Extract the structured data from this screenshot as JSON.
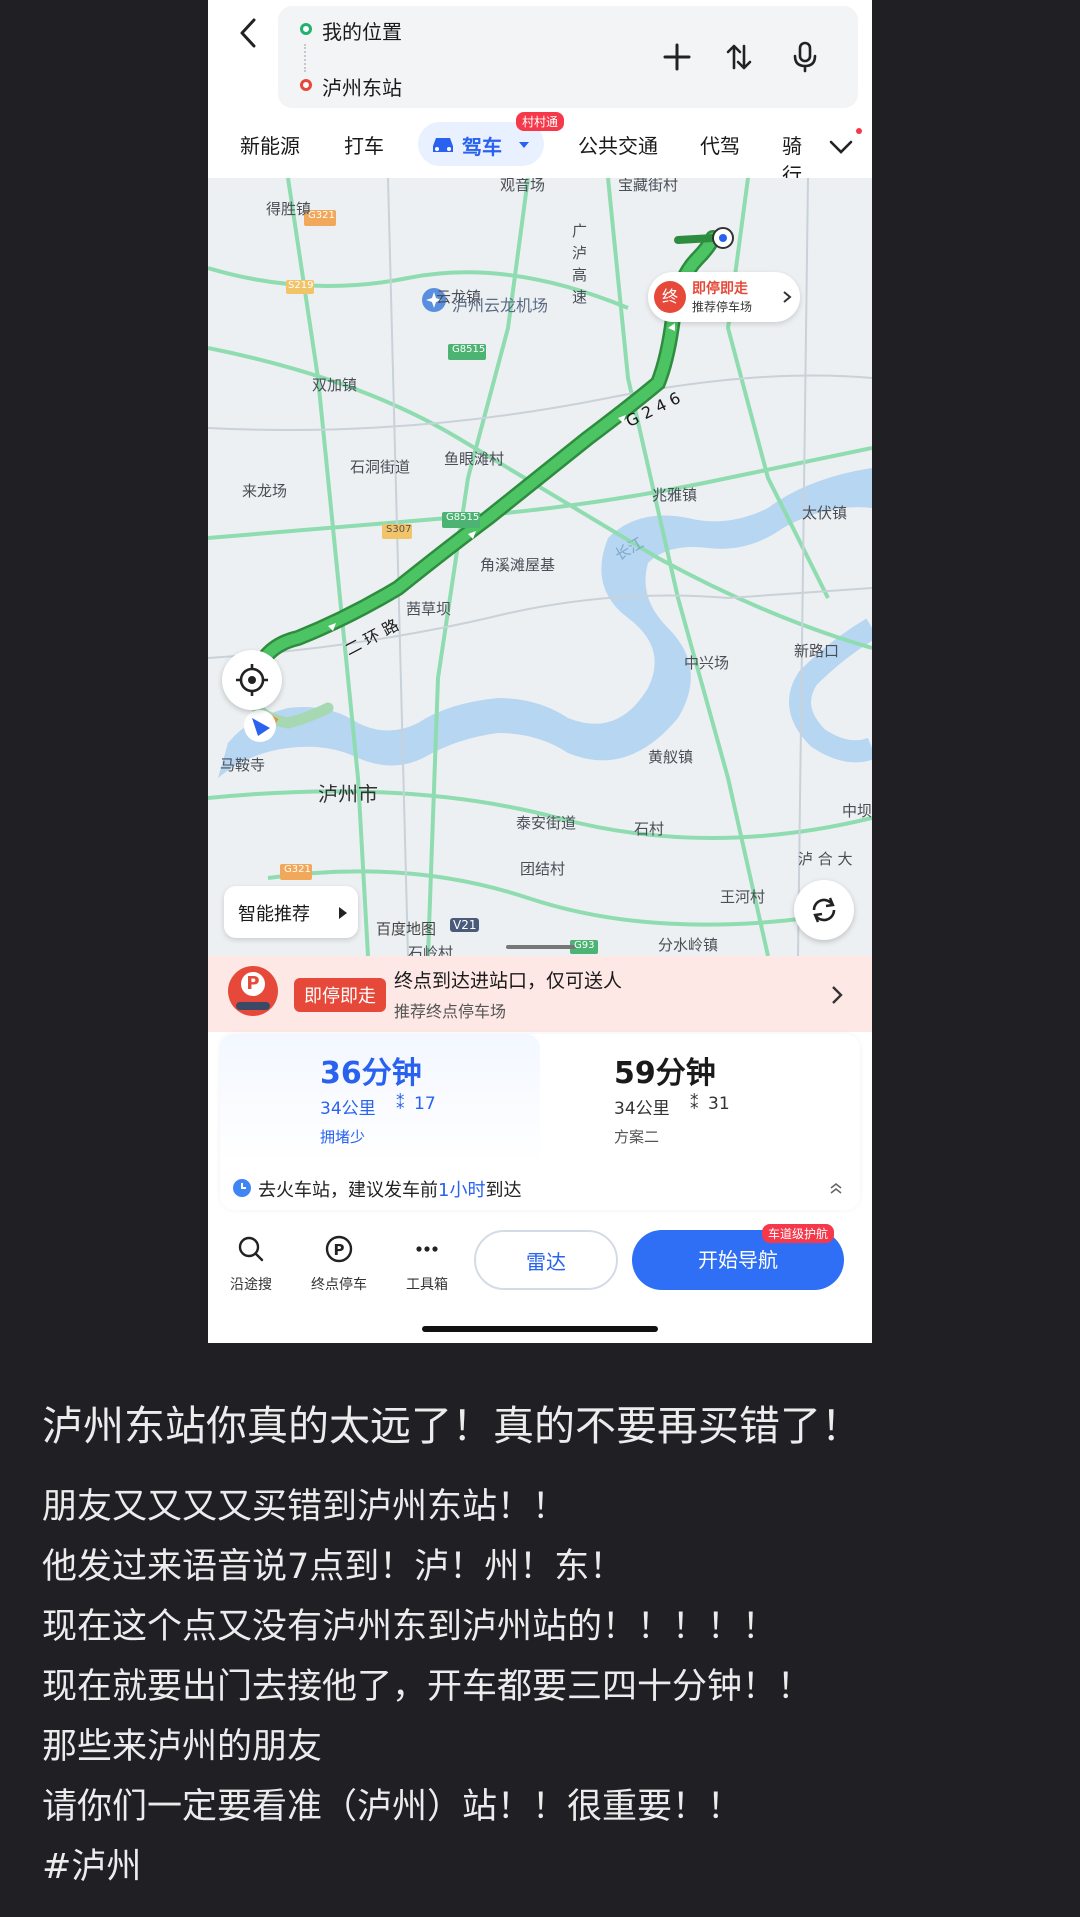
{
  "route": {
    "origin": "我的位置",
    "destination": "泸州东站",
    "origin_color": "#23b26d",
    "destination_color": "#e6493a"
  },
  "modes": {
    "items": [
      "新能源",
      "打车",
      "驾车",
      "公共交通",
      "代驾",
      "骑行"
    ],
    "active": "驾车",
    "active_badge": "村村通"
  },
  "map": {
    "labels": {
      "guanyinchang": "观音场",
      "baozang": "宝藏街村",
      "desheng": "得胜镇",
      "g321a": "G321",
      "yunlong": "云龙镇",
      "lu_highway": "广 泸 高 速",
      "s219": "S219",
      "airport": "泸州云龙机场",
      "shuangjia": "双加镇",
      "g8515a": "G8515",
      "shidong": "石洞街道",
      "yuyan": "鱼眼滩村",
      "zhaoya": "兆雅镇",
      "taifu": "太伏镇",
      "lailong": "来龙场",
      "road_g246": "G 2 4 6",
      "road_ring": "二 环 路",
      "changjiang": "长江",
      "s307": "S307",
      "g8515b": "G8515",
      "jiaoxitan": "角溪滩屋基",
      "zhongxing": "中兴场",
      "xinlukou": "新路口",
      "qiancaoba": "茜草坝",
      "masi": "马鞍寺",
      "luzhou_city": "泸州市",
      "huangyi": "黄舣镇",
      "taian": "泰安街道",
      "shicun": "石村",
      "zhongba": "中坝",
      "tuanjie": "团结村",
      "luhe": "泸 合 大",
      "wanghe": "王河村",
      "g321b": "G321",
      "fenshui": "分水岭镇",
      "shilingcun": "石岭村",
      "g93": "G93",
      "baidu": "百度地图",
      "baidu_ver": "V21"
    },
    "parking_chip": {
      "marker": "终",
      "title": "即停即走",
      "subtitle": "推荐停车场"
    },
    "smart_recommend": "智能推荐",
    "route_color": "#3cb455"
  },
  "alert": {
    "tag": "即停即走",
    "title": "终点到达进站口，仅可送人",
    "subtitle": "推荐终点停车场"
  },
  "plans": [
    {
      "time": "36分钟",
      "distance": "34公里",
      "lights": "17",
      "note": "拥堵少",
      "selected": true
    },
    {
      "time": "59分钟",
      "distance": "34公里",
      "lights": "31",
      "note": "方案二",
      "selected": false
    }
  ],
  "tip": {
    "prefix": "去火车站，建议发车前",
    "highlight": "1小时",
    "suffix": "到达"
  },
  "bottom": {
    "tools": [
      "沿途搜",
      "终点停车",
      "工具箱"
    ],
    "radar": "雷达",
    "start_nav": "开始导航",
    "nav_badge": "车道级护航"
  },
  "post": {
    "title": "泸州东站你真的太远了！真的不要再买错了！",
    "lines": [
      "朋友又又又又买错到泸州东站！！",
      "他发过来语音说7点到！泸！州！东！",
      "现在这个点又没有泸州东到泸州站的！！！！！",
      "现在就要出门去接他了，开车都要三四十分钟！！",
      "那些来泸州的朋友",
      "请你们一定要看准（泸州）站！！很重要！！",
      "#泸州"
    ]
  }
}
